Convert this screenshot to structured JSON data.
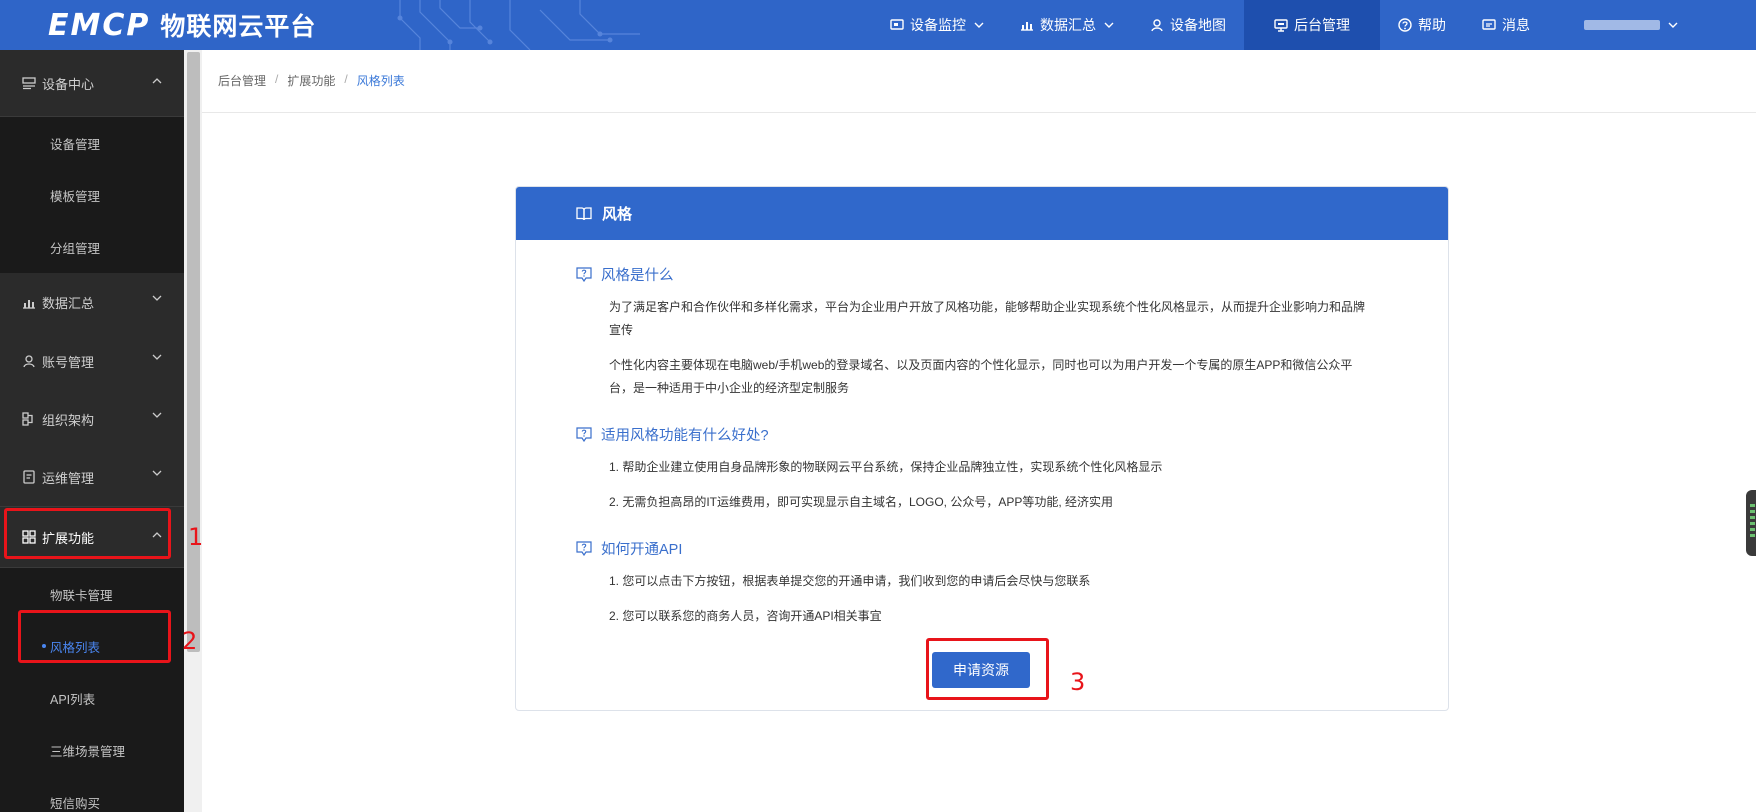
{
  "header": {
    "logo_mark": "EMCP",
    "logo_text": "物联网云平台",
    "nav": [
      {
        "label": "设备监控",
        "icon": "monitor-icon",
        "dropdown": true
      },
      {
        "label": "数据汇总",
        "icon": "chart-icon",
        "dropdown": true
      },
      {
        "label": "设备地图",
        "icon": "user-pin-icon",
        "dropdown": false
      },
      {
        "label": "后台管理",
        "icon": "admin-icon",
        "dropdown": false,
        "active": true
      },
      {
        "label": "帮助",
        "icon": "help-icon",
        "dropdown": false
      },
      {
        "label": "消息",
        "icon": "message-icon",
        "dropdown": false
      }
    ],
    "user_dropdown": true
  },
  "sidebar": {
    "groups": [
      {
        "label": "设备中心",
        "icon": "device-icon",
        "open": true,
        "items": [
          "设备管理",
          "模板管理",
          "分组管理"
        ]
      },
      {
        "label": "数据汇总",
        "icon": "chart-icon",
        "open": false
      },
      {
        "label": "账号管理",
        "icon": "user-icon",
        "open": false
      },
      {
        "label": "组织架构",
        "icon": "org-icon",
        "open": false
      },
      {
        "label": "运维管理",
        "icon": "ops-icon",
        "open": false
      },
      {
        "label": "扩展功能",
        "icon": "grid-icon",
        "open": true,
        "items": [
          "物联卡管理",
          "风格列表",
          "API列表",
          "三维场景管理",
          "短信购买"
        ],
        "active_item": "风格列表"
      }
    ]
  },
  "breadcrumb": [
    "后台管理",
    "扩展功能",
    "风格列表"
  ],
  "card": {
    "title": "风格",
    "sections": [
      {
        "title": "风格是什么",
        "paragraphs": [
          "为了满足客户和合作伙伴和多样化需求，平台为企业用户开放了风格功能，能够帮助企业实现系统个性化风格显示，从而提升企业影响力和品牌宣传",
          "个性化内容主要体现在电脑web/手机web的登录域名、以及页面内容的个性化显示，同时也可以为用户开发一个专属的原生APP和微信公众平台，是一种适用于中小企业的经济型定制服务"
        ]
      },
      {
        "title": "适用风格功能有什么好处?",
        "paragraphs": [
          "1. 帮助企业建立使用自身品牌形象的物联网云平台系统，保持企业品牌独立性，实现系统个性化风格显示",
          "2. 无需负担高昂的IT运维费用，即可实现显示自主域名，LOGO, 公众号，APP等功能, 经济实用"
        ]
      },
      {
        "title": "如何开通API",
        "paragraphs": [
          "1. 您可以点击下方按钮，根据表单提交您的开通申请，我们收到您的申请后会尽快与您联系",
          "2. 您可以联系您的商务人员，咨询开通API相关事宜"
        ]
      }
    ],
    "button_label": "申请资源"
  },
  "annotations": [
    "1",
    "2",
    "3"
  ],
  "colors": {
    "primary": "#3068cb",
    "highlight": "#e8141a",
    "sidebar_bg": "#1f1f1f"
  }
}
